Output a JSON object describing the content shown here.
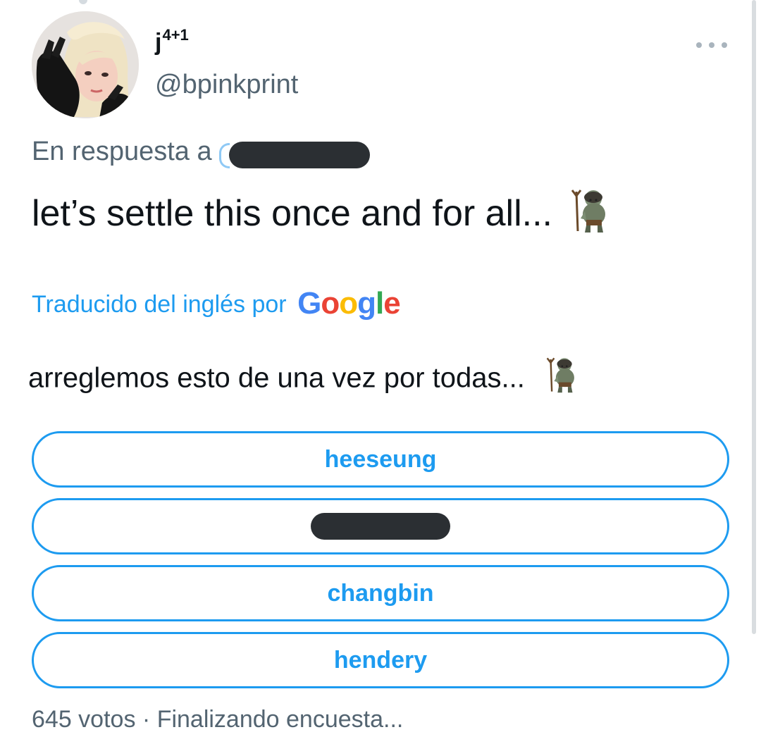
{
  "tweet": {
    "display_name": "j",
    "display_name_sup": "4+1",
    "handle": "@bpinkprint",
    "more_icon": "more-horizontal-icon",
    "reply_prefix": "En respuesta a",
    "reply_mention": "@",
    "text": "let’s settle this once and for all...",
    "text_emoji": "troll-emoji",
    "translated_label": "Traducido del inglés por",
    "translator_logo": "Google",
    "translation": "arreglemos esto de una vez por todas...",
    "translation_emoji": "troll-emoji"
  },
  "poll": {
    "options": [
      {
        "label": "heeseung",
        "redacted": false
      },
      {
        "label": "",
        "redacted": true
      },
      {
        "label": "changbin",
        "redacted": false
      },
      {
        "label": "hendery",
        "redacted": false
      }
    ],
    "votes": "645 votos",
    "separator": "·",
    "status": "Finalizando encuesta..."
  },
  "colors": {
    "accent": "#1d9bf0",
    "text": "#0f1419",
    "secondary": "#536471",
    "redaction": "#2b2f33"
  }
}
